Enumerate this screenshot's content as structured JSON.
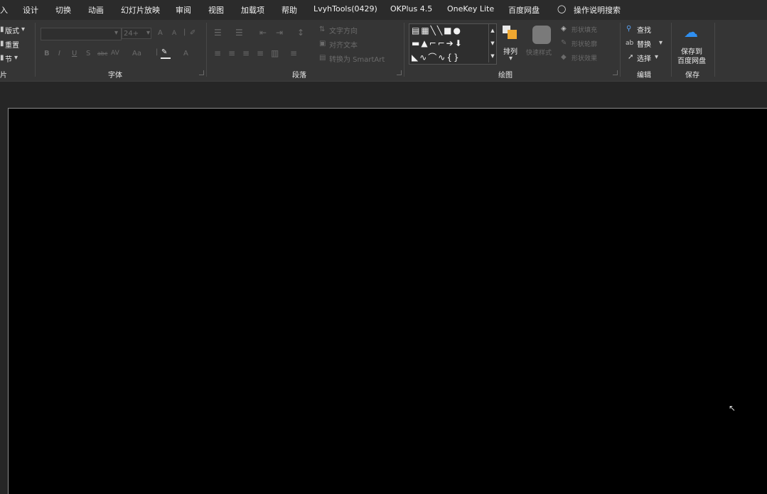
{
  "tabs": [
    {
      "label": "入"
    },
    {
      "label": "设计"
    },
    {
      "label": "切换"
    },
    {
      "label": "动画"
    },
    {
      "label": "幻灯片放映"
    },
    {
      "label": "审阅"
    },
    {
      "label": "视图"
    },
    {
      "label": "加载项"
    },
    {
      "label": "帮助"
    },
    {
      "label": "LvyhTools(0429)"
    },
    {
      "label": "OKPlus 4.5"
    },
    {
      "label": "OneKey Lite"
    },
    {
      "label": "百度网盘"
    }
  ],
  "tell_me": {
    "label": "操作说明搜索",
    "icon": "lightbulb-icon"
  },
  "ribbon": {
    "slides": {
      "layout": "版式",
      "reset": "重置",
      "section": "节",
      "group_label": "片"
    },
    "font": {
      "size_placeholder": "24+",
      "grow": "A",
      "shrink": "A",
      "bold": "B",
      "italic": "I",
      "underline": "U",
      "shadow": "S",
      "strike": "abc",
      "spacing": "AV",
      "case": "Aa",
      "color": "A",
      "group_label": "字体"
    },
    "paragraph": {
      "text_direction": "文字方向",
      "align_text": "对齐文本",
      "smartart": "转换为 SmartArt",
      "group_label": "段落"
    },
    "drawing": {
      "arrange": "排列",
      "quick_styles": "快速样式",
      "shape_fill": "形状填充",
      "shape_outline": "形状轮廓",
      "shape_effects": "形状效果",
      "group_label": "绘图"
    },
    "editing": {
      "find": "查找",
      "replace": "替换",
      "select": "选择",
      "group_label": "编辑"
    },
    "save": {
      "line1": "保存到",
      "line2": "百度网盘",
      "group_label": "保存"
    }
  },
  "colors": {
    "ribbon_bg": "#353535",
    "tabs_bg": "#2b2b2b",
    "work_bg": "#262626",
    "slide_bg": "#000000",
    "accent_orange": "#f0a830",
    "baidu_blue": "#2f8ff0"
  }
}
